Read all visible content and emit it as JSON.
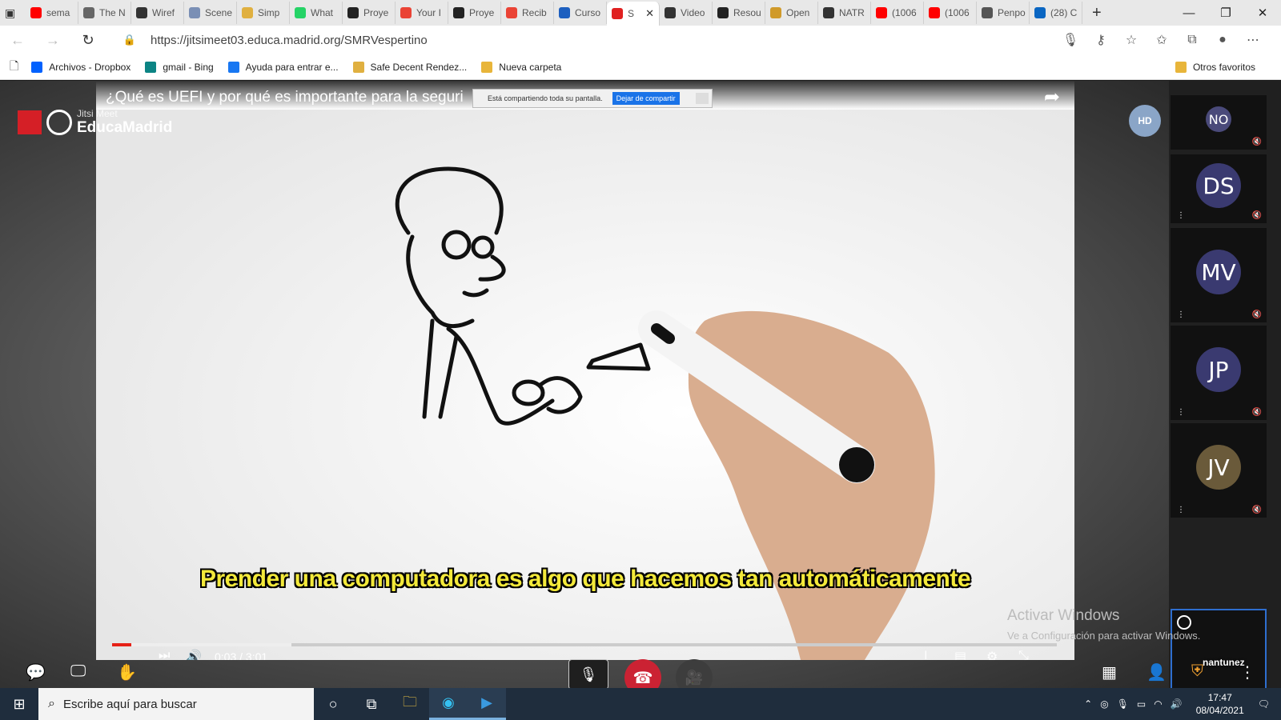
{
  "browser": {
    "tabs": [
      {
        "label": "sema",
        "color": "#ff0000"
      },
      {
        "label": "The N",
        "color": "#666666"
      },
      {
        "label": "Wiref",
        "color": "#333333"
      },
      {
        "label": "Scene",
        "color": "#7a8fb5"
      },
      {
        "label": "Simp",
        "color": "#e0b040"
      },
      {
        "label": "What",
        "color": "#25d366"
      },
      {
        "label": "Proye",
        "color": "#222222"
      },
      {
        "label": "Your I",
        "color": "#ea4335"
      },
      {
        "label": "Proye",
        "color": "#222222"
      },
      {
        "label": "Recib",
        "color": "#ea4335"
      },
      {
        "label": "Curso",
        "color": "#1d5fbf"
      },
      {
        "label": "S",
        "color": "#e02020",
        "active": true
      },
      {
        "label": "Video",
        "color": "#333333"
      },
      {
        "label": "Resou",
        "color": "#222222"
      },
      {
        "label": "Open",
        "color": "#d09a2a"
      },
      {
        "label": "NATR",
        "color": "#333333"
      },
      {
        "label": "(1006",
        "color": "#ff0000"
      },
      {
        "label": "(1006",
        "color": "#ff0000"
      },
      {
        "label": "Penpo",
        "color": "#555555"
      },
      {
        "label": "(28) C",
        "color": "#0a66c2"
      }
    ],
    "url": "https://jitsimeet03.educa.madrid.org/SMRVespertino",
    "bookmarks": [
      {
        "label": "Archivos - Dropbox",
        "color": "#0061fe"
      },
      {
        "label": "gmail - Bing",
        "color": "#0c8484"
      },
      {
        "label": "Ayuda para entrar e...",
        "color": "#1877f2"
      },
      {
        "label": "Safe Decent Rendez...",
        "color": "#e0b040"
      },
      {
        "label": "Nueva carpeta",
        "color": "#e8b53a"
      }
    ],
    "other_favorites": "Otros favoritos"
  },
  "meeting": {
    "logo_small": "Jitsi Meet",
    "logo_big": "EducaMadrid",
    "hd_badge": "HD",
    "video_title": "¿Qué es UEFI y por qué es importante para la seguri",
    "share_notice": "Está compartiendo toda su pantalla.",
    "stop_share": "Dejar de compartir",
    "subtitle": "Prender una computadora es algo que hacemos tan automáticamente",
    "time": "0:03 / 3:01",
    "progress": 0.02,
    "participants": [
      {
        "initials": "NO",
        "color": "#4a4a7a"
      },
      {
        "initials": "DS",
        "color": "#3a3a70"
      },
      {
        "initials": "MV",
        "color": "#3a3a70"
      },
      {
        "initials": "JP",
        "color": "#3a3a70"
      },
      {
        "initials": "JV",
        "color": "#6a5a3a"
      }
    ],
    "self_name": "nantunez",
    "watermark_line1": "Activar Windows",
    "watermark_line2": "Ve a Configuración para activar Windows."
  },
  "taskbar": {
    "search_placeholder": "Escribe aquí para buscar",
    "time": "17:47",
    "date": "08/04/2021"
  }
}
